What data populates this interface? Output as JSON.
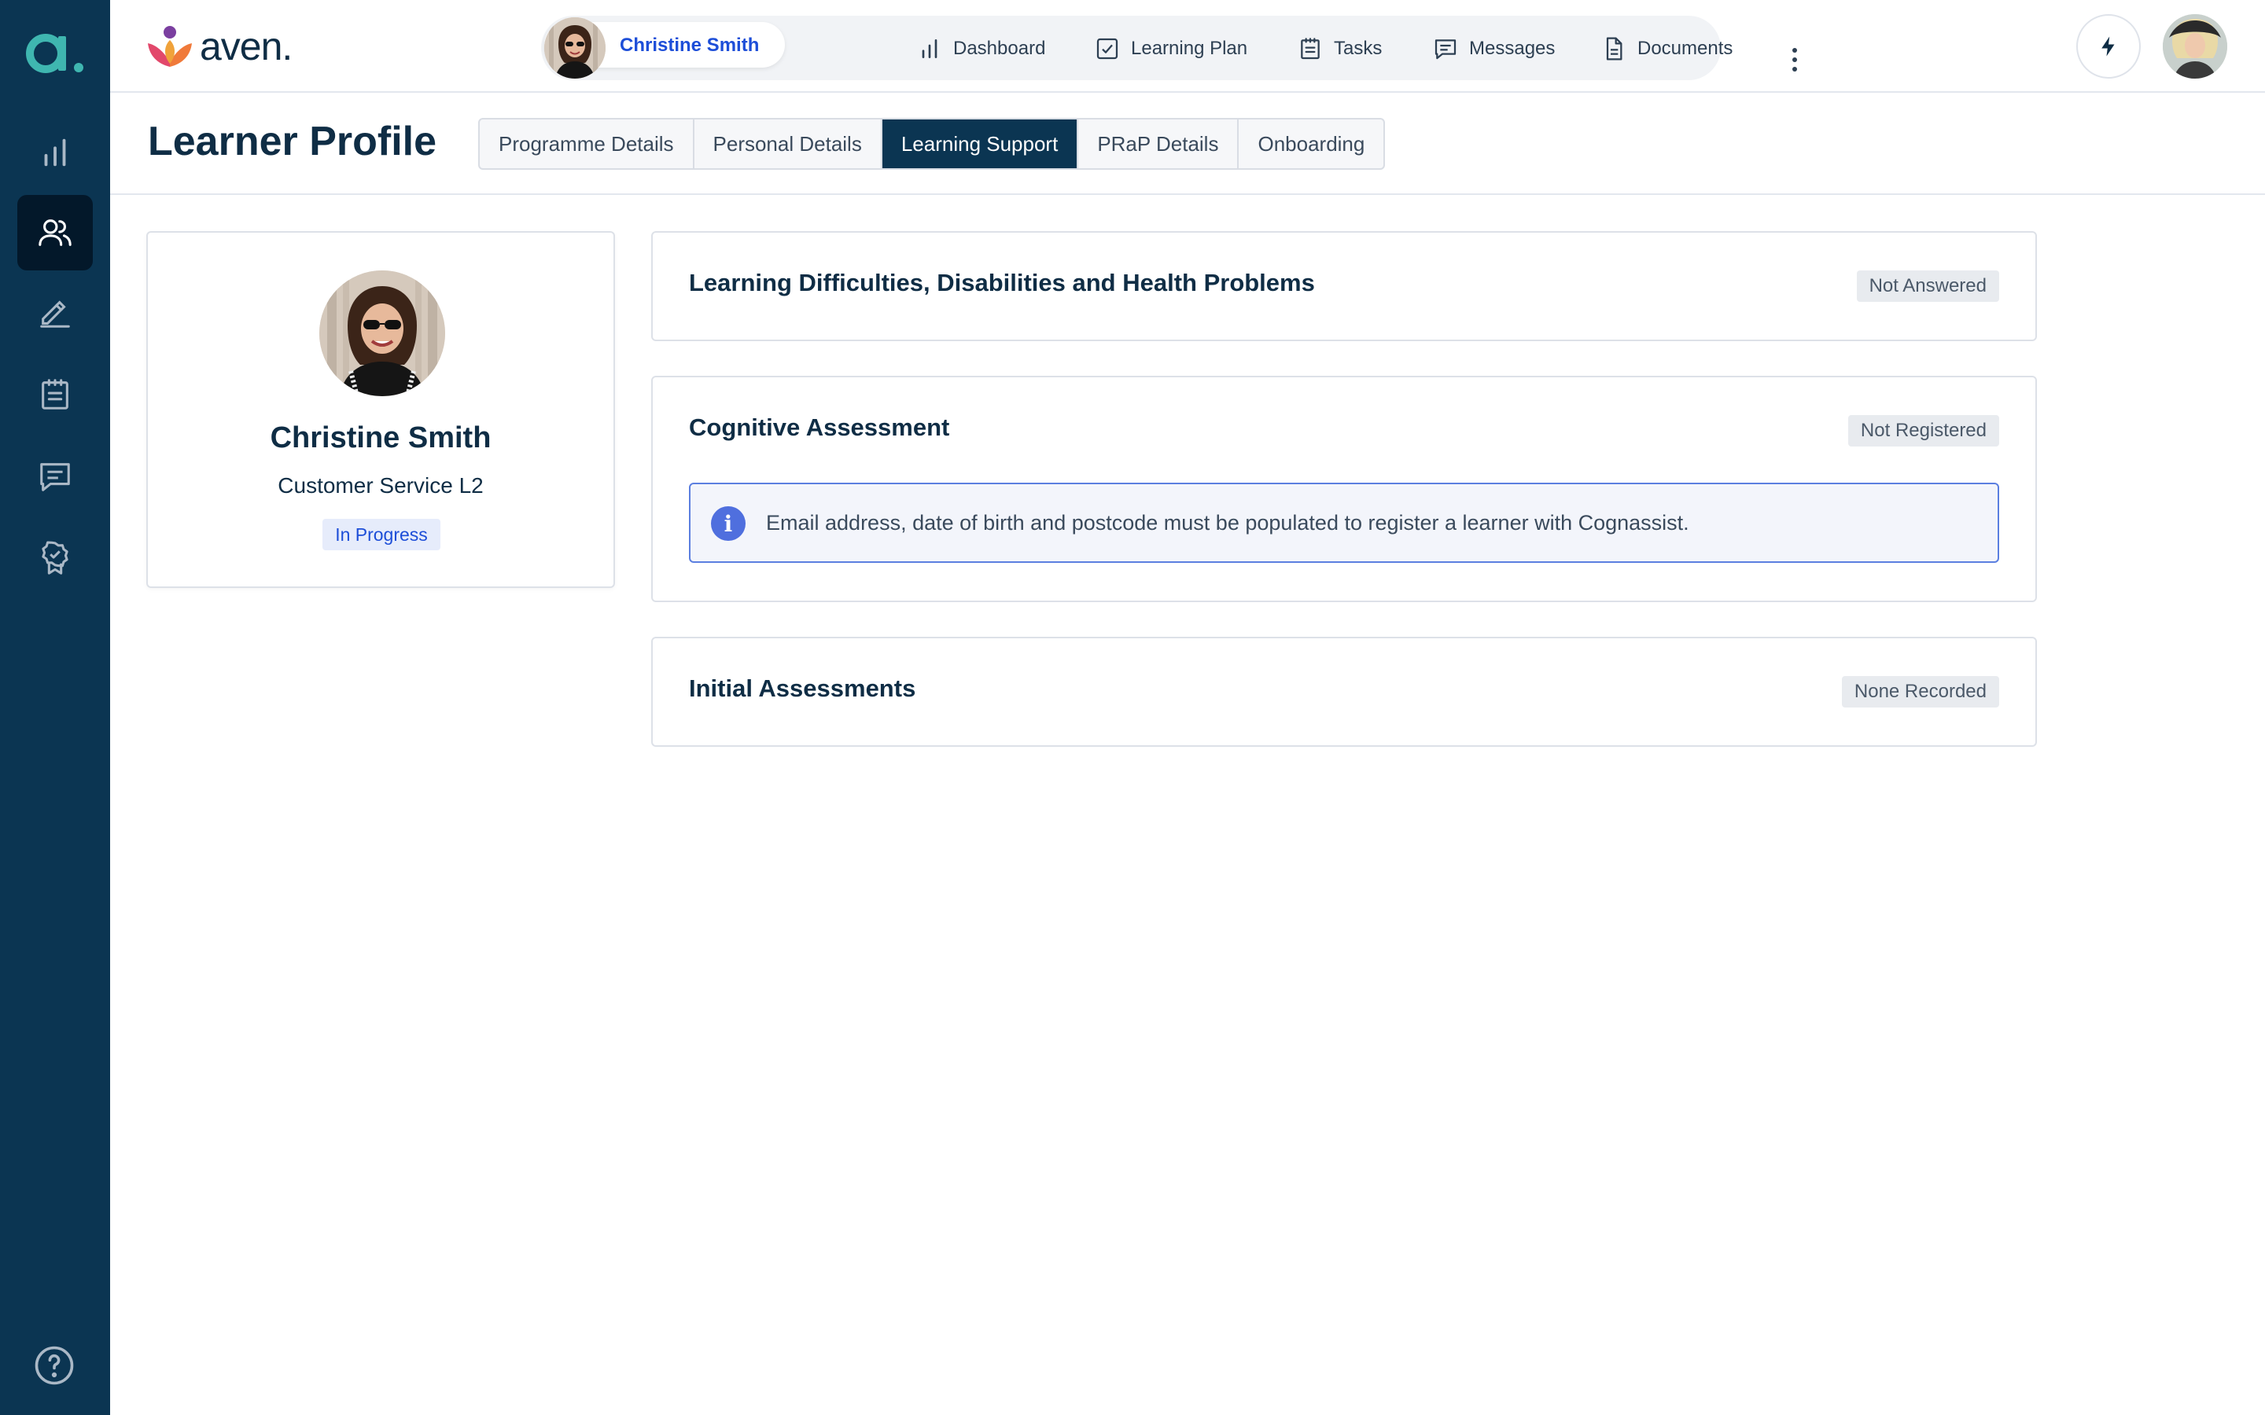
{
  "rail": {
    "logo_letter": "a.",
    "items": [
      {
        "name": "reports",
        "icon": "bar-chart-icon"
      },
      {
        "name": "learners",
        "icon": "users-icon",
        "active": true
      },
      {
        "name": "signatures",
        "icon": "pen-sign-icon"
      },
      {
        "name": "tasks",
        "icon": "clipboard-icon"
      },
      {
        "name": "messages",
        "icon": "chat-icon"
      },
      {
        "name": "achievements",
        "icon": "badge-icon"
      }
    ],
    "help_icon": "help-icon"
  },
  "header": {
    "brand": "aven.",
    "learner_chip": {
      "name": "Christine Smith"
    },
    "nav": [
      {
        "label": "Dashboard",
        "icon": "bar-chart-icon"
      },
      {
        "label": "Learning Plan",
        "icon": "checkbox-icon"
      },
      {
        "label": "Tasks",
        "icon": "clipboard-icon"
      },
      {
        "label": "Messages",
        "icon": "chat-icon"
      },
      {
        "label": "Documents",
        "icon": "document-icon"
      }
    ]
  },
  "page": {
    "title": "Learner Profile",
    "tabs": [
      {
        "label": "Programme Details"
      },
      {
        "label": "Personal Details"
      },
      {
        "label": "Learning Support",
        "active": true
      },
      {
        "label": "PRaP Details"
      },
      {
        "label": "Onboarding"
      }
    ]
  },
  "profile": {
    "name": "Christine Smith",
    "course": "Customer Service L2",
    "status": "In Progress"
  },
  "sections": [
    {
      "title": "Learning Difficulties, Disabilities and Health Problems",
      "badge": "Not Answered"
    },
    {
      "title": "Cognitive Assessment",
      "badge": "Not Registered",
      "info": "Email address, date of birth and postcode must be populated to register a learner with Cognassist."
    },
    {
      "title": "Initial Assessments",
      "badge": "None Recorded"
    }
  ],
  "colors": {
    "rail_bg": "#0b3552",
    "rail_active": "#03182a",
    "accent_blue": "#1d4ed8",
    "info_border": "#5b7fe0"
  }
}
